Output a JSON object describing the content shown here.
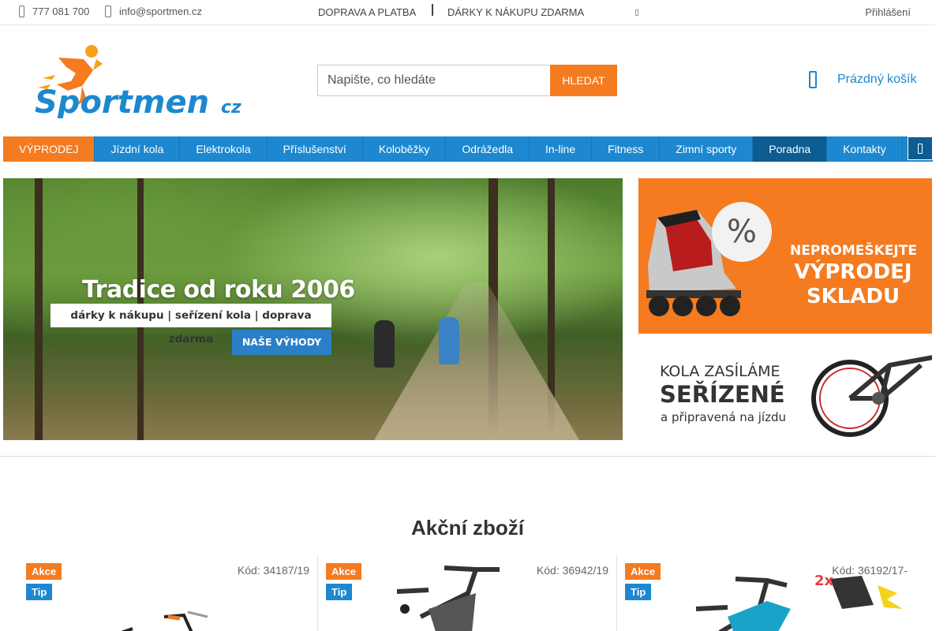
{
  "topbar": {
    "phone": "777 081 700",
    "email": "info@sportmen.cz",
    "links": [
      "DOPRAVA A PLATBA",
      "DÁRKY K NÁKUPU ZDARMA"
    ],
    "login": "Přihlášení"
  },
  "logo": {
    "main": "Sportmen",
    "suffix": "cz"
  },
  "search": {
    "placeholder": "Napište, co hledáte",
    "button": "HLEDAT"
  },
  "cart": {
    "label": "Prázdný košík"
  },
  "nav": {
    "items": [
      "VÝPRODEJ",
      "Jízdní kola",
      "Elektrokola",
      "Příslušenství",
      "Koloběžky",
      "Odrážedla",
      "In-line",
      "Fitness",
      "Zimní sporty",
      "Poradna",
      "Kontakty"
    ]
  },
  "hero": {
    "title": "Tradice od roku 2006",
    "subtitle": "dárky k nákupu | seřízení kola | doprava zdarma",
    "button": "NAŠE VÝHODY"
  },
  "promo1": {
    "percent": "%",
    "line1": "NEPROMEŠKEJTE",
    "line2": "VÝPRODEJ",
    "line3": "SKLADU"
  },
  "promo2": {
    "line1": "KOLA ZASÍLÁME",
    "line2": "SEŘÍZENÉ",
    "line3": "a připravená na jízdu"
  },
  "section": {
    "title": "Akční zboží"
  },
  "products": [
    {
      "badges": [
        "Akce",
        "Tip"
      ],
      "code": "Kód: 34187/19"
    },
    {
      "badges": [
        "Akce",
        "Tip"
      ],
      "code": "Kód: 36942/19"
    },
    {
      "badges": [
        "Akce",
        "Tip"
      ],
      "code": "Kód: 36192/17-",
      "promo": "2x"
    }
  ],
  "colors": {
    "brand_orange": "#f47b20",
    "brand_blue": "#1d88cf",
    "nav_active": "#0d5c92"
  }
}
